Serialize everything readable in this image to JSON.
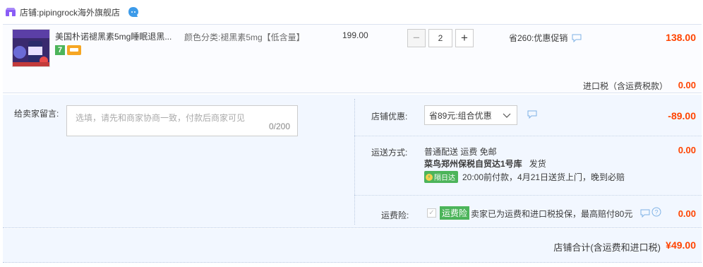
{
  "shop": {
    "label": "店铺:",
    "name": "pipingrock海外旗舰店",
    "wang_icon": "wangwang-chat-icon"
  },
  "item": {
    "title": "美国朴诺褪黑素5mg睡眠退黑...",
    "badge_7": "7",
    "sku": "颜色分类:褪黑素5mg【低含量】",
    "unit_price": "199.00",
    "quantity": "2",
    "minus_label": "−",
    "plus_label": "+",
    "promo": "省260:优惠促销",
    "total": "138.00",
    "tax_label": "进口税（含运费税款）",
    "tax_value": "0.00"
  },
  "message": {
    "label": "给卖家留言:",
    "placeholder": "选填，请先和商家协商一致，付款后商家可见",
    "counter": "0/200"
  },
  "coupon": {
    "label": "店铺优惠:",
    "selected": "省89元:组合优惠",
    "value": "-89.00"
  },
  "shipping": {
    "label": "运送方式:",
    "method": "普通配送 运费 免邮",
    "warehouse": "菜鸟郑州保税自贸达1号库",
    "dispatch": "发货",
    "next_day_tag": "隔日达",
    "delivery_note": "20:00前付款，4月21日送货上门，晚到必赔",
    "value": "0.00"
  },
  "insurance": {
    "label": "运费险:",
    "tag": "运费险",
    "text": "卖家已为运费和进口税投保，最高赔付80元",
    "value": "0.00"
  },
  "summary": {
    "label": "店铺合计(含运费和进口税)",
    "value": "¥49.00"
  },
  "colors": {
    "price_red": "#ff4400",
    "green": "#4cb45a",
    "panel_blue": "#f2f7ff"
  }
}
